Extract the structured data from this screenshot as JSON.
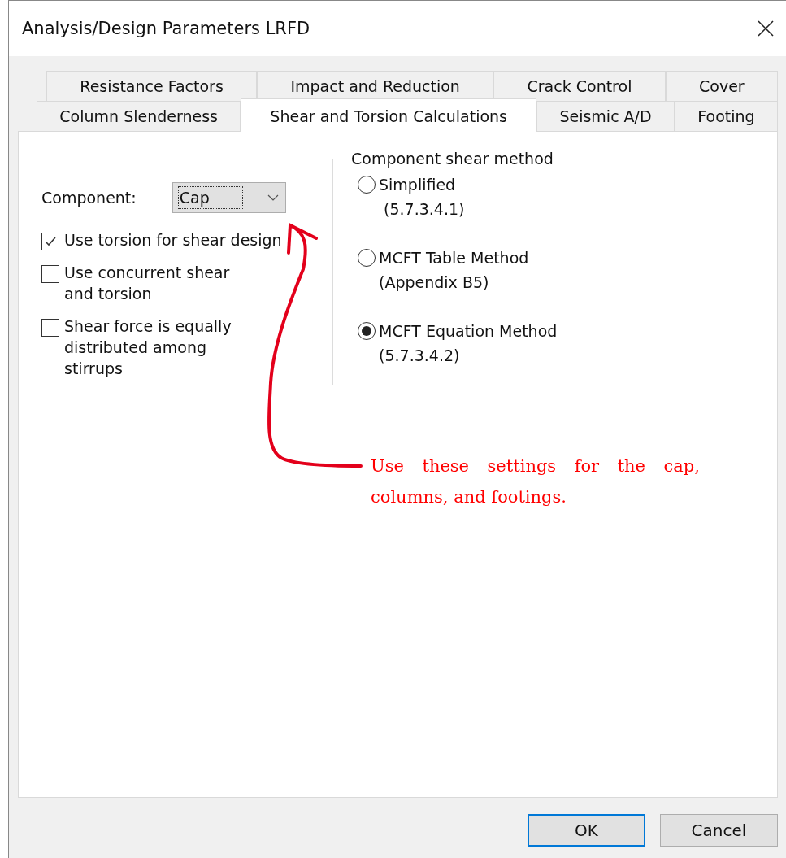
{
  "window": {
    "title": "Analysis/Design Parameters LRFD"
  },
  "tab_rows": [
    [
      {
        "label": "Resistance Factors",
        "selected": false
      },
      {
        "label": "Impact and Reduction",
        "selected": false
      },
      {
        "label": "Crack Control",
        "selected": false
      },
      {
        "label": "Cover",
        "selected": false
      }
    ],
    [
      {
        "label": "Column Slenderness",
        "selected": false
      },
      {
        "label": "Shear and Torsion Calculations",
        "selected": true
      },
      {
        "label": "Seismic A/D",
        "selected": false
      },
      {
        "label": "Footing",
        "selected": false
      }
    ]
  ],
  "component": {
    "label": "Component:",
    "value": "Cap"
  },
  "checkboxes": [
    {
      "label": "Use torsion for shear design",
      "checked": true
    },
    {
      "label": "Use concurrent shear and torsion",
      "checked": false
    },
    {
      "label": "Shear force is equally distributed among stirrups",
      "checked": false
    }
  ],
  "shear_method": {
    "title": "Component shear method",
    "options": [
      {
        "label": "Simplified",
        "reference": "(5.7.3.4.1)",
        "selected": false
      },
      {
        "label": "MCFT Table Method",
        "reference": "(Appendix B5)",
        "selected": false
      },
      {
        "label": "MCFT Equation Method",
        "reference": "(5.7.3.4.2)",
        "selected": true
      }
    ]
  },
  "annotation": {
    "text": "Use these settings for the cap, columns, and footings."
  },
  "buttons": [
    {
      "label": "OK",
      "default": true
    },
    {
      "label": "Cancel",
      "default": false
    }
  ]
}
